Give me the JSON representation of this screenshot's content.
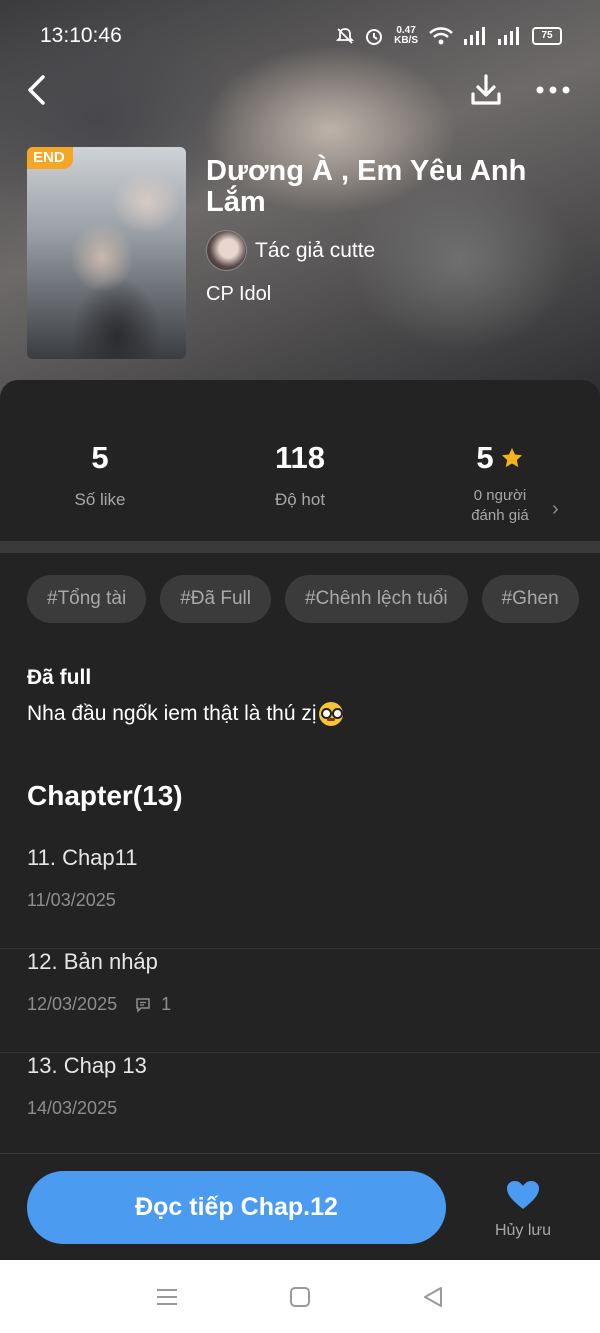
{
  "status_bar": {
    "time": "13:10:46",
    "net_speed_value": "0.47",
    "net_speed_unit": "KB/S",
    "battery": "75"
  },
  "story": {
    "badge": "END",
    "title": "Dương À , Em Yêu Anh Lắm",
    "author": "Tác giả cutte",
    "category": "CP Idol"
  },
  "stats": {
    "likes_value": "5",
    "likes_label": "Số like",
    "hot_value": "118",
    "hot_label": "Độ hot",
    "rating_value": "5",
    "rating_label_line1": "0 người",
    "rating_label_line2": "đánh giá"
  },
  "tags": [
    "#Tổng tài",
    "#Đã Full",
    "#Chênh lệch tuổi",
    "#Ghen"
  ],
  "description": {
    "title": "Đã full",
    "text": "Nha đầu ngốk iem thật là thú zị"
  },
  "chapters": {
    "header": "Chapter(13)",
    "items": [
      {
        "name": "11. Chap11",
        "date": "11/03/2025",
        "comments": ""
      },
      {
        "name": "12. Bản nháp",
        "date": "12/03/2025",
        "comments": "1"
      },
      {
        "name": "13. Chap 13",
        "date": "14/03/2025",
        "comments": ""
      }
    ]
  },
  "bottom": {
    "read_button": "Đọc tiếp Chap.12",
    "unsave_label": "Hủy lưu"
  },
  "colors": {
    "accent": "#4b9cf0",
    "badge": "#f5a623",
    "star": "#f5b31b",
    "background": "#232323"
  },
  "icons": [
    "back-arrow-icon",
    "download-icon",
    "more-icon",
    "star-icon",
    "chevron-right-icon",
    "comment-icon",
    "heart-icon",
    "menu-icon",
    "home-icon",
    "back-triangle-icon"
  ]
}
